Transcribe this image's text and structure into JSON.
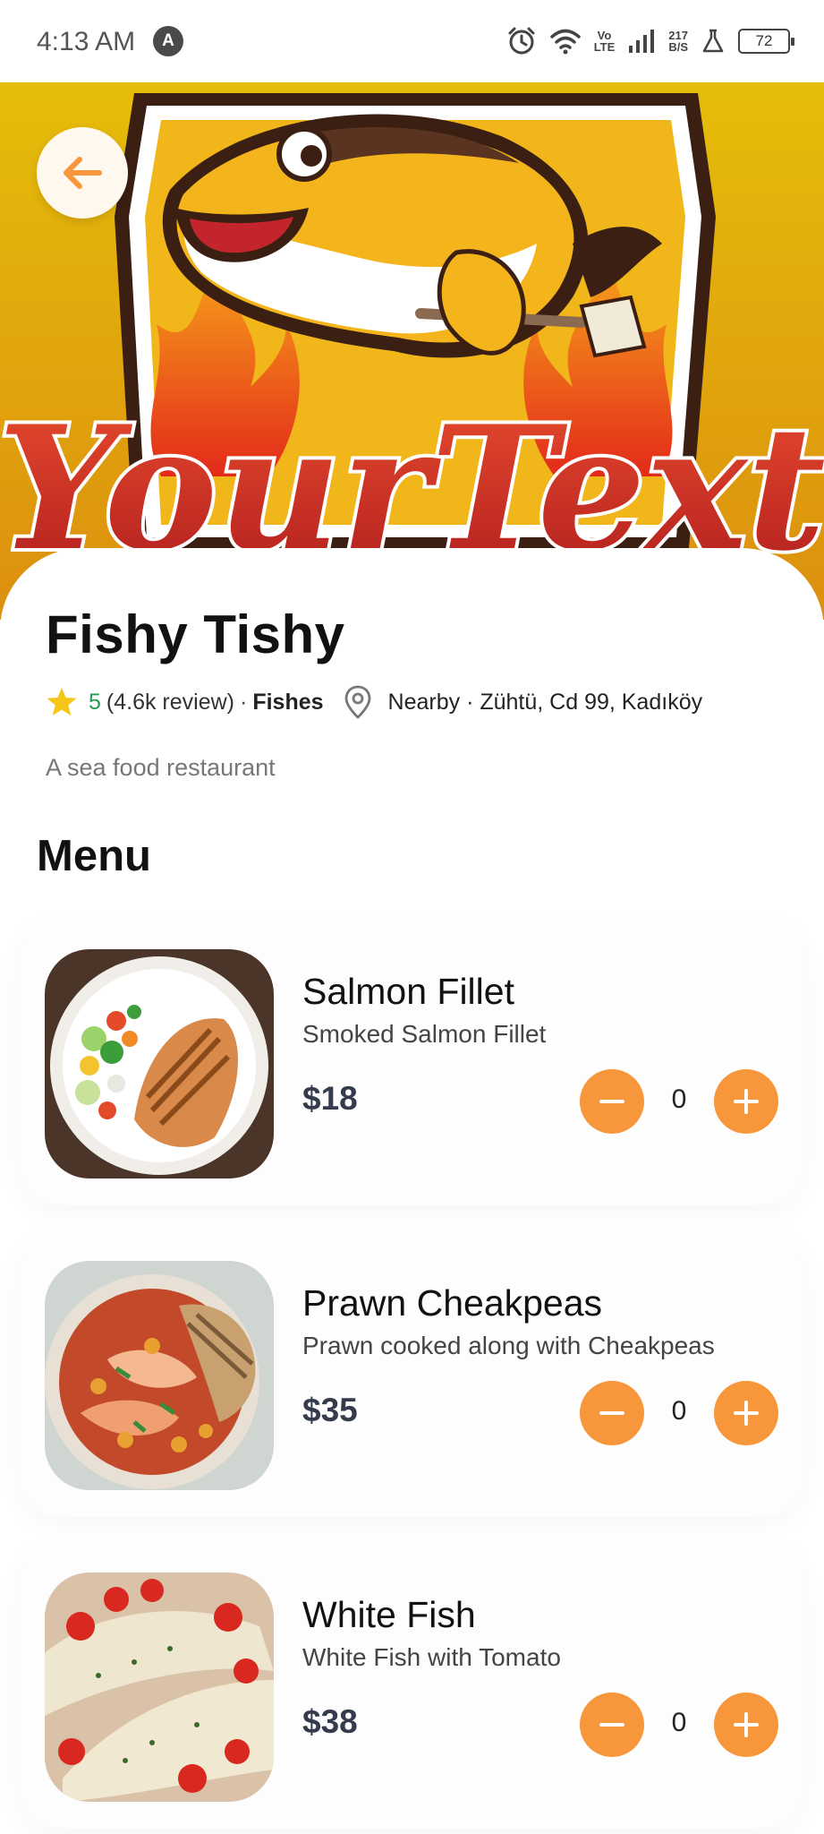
{
  "status_bar": {
    "time": "4:13 AM",
    "a_badge": "A",
    "net_label_top": "Vo",
    "net_label_bottom": "LTE",
    "speed_top": "217",
    "speed_bottom": "B/S",
    "battery": "72"
  },
  "hero": {
    "logo_text": "YourText"
  },
  "restaurant": {
    "name": "Fishy Tishy",
    "rating": "5",
    "reviews": "(4.6k review)",
    "separator": "·",
    "category": "Fishes",
    "location": "Nearby · Zühtü, Cd 99,  Kadıköy",
    "description": "A sea food restaurant"
  },
  "menu": {
    "heading": "Menu",
    "items": [
      {
        "name": "Salmon Fillet",
        "subtitle": "Smoked Salmon Fillet",
        "price": "$18",
        "quantity": "0"
      },
      {
        "name": "Prawn Cheakpeas",
        "subtitle": "Prawn cooked along with Cheakpeas",
        "price": "$35",
        "quantity": "0"
      },
      {
        "name": "White Fish",
        "subtitle": "White Fish with Tomato",
        "price": "$38",
        "quantity": "0"
      }
    ]
  },
  "colors": {
    "accent": "#f7963b",
    "rating_green": "#2a9a52",
    "star": "#f5c518",
    "hero_yellow": "#e6bd0a"
  },
  "icons": {
    "back": "arrow-left-icon",
    "star": "star-icon",
    "location": "location-pin-icon",
    "minus": "minus-icon",
    "plus": "plus-icon"
  }
}
